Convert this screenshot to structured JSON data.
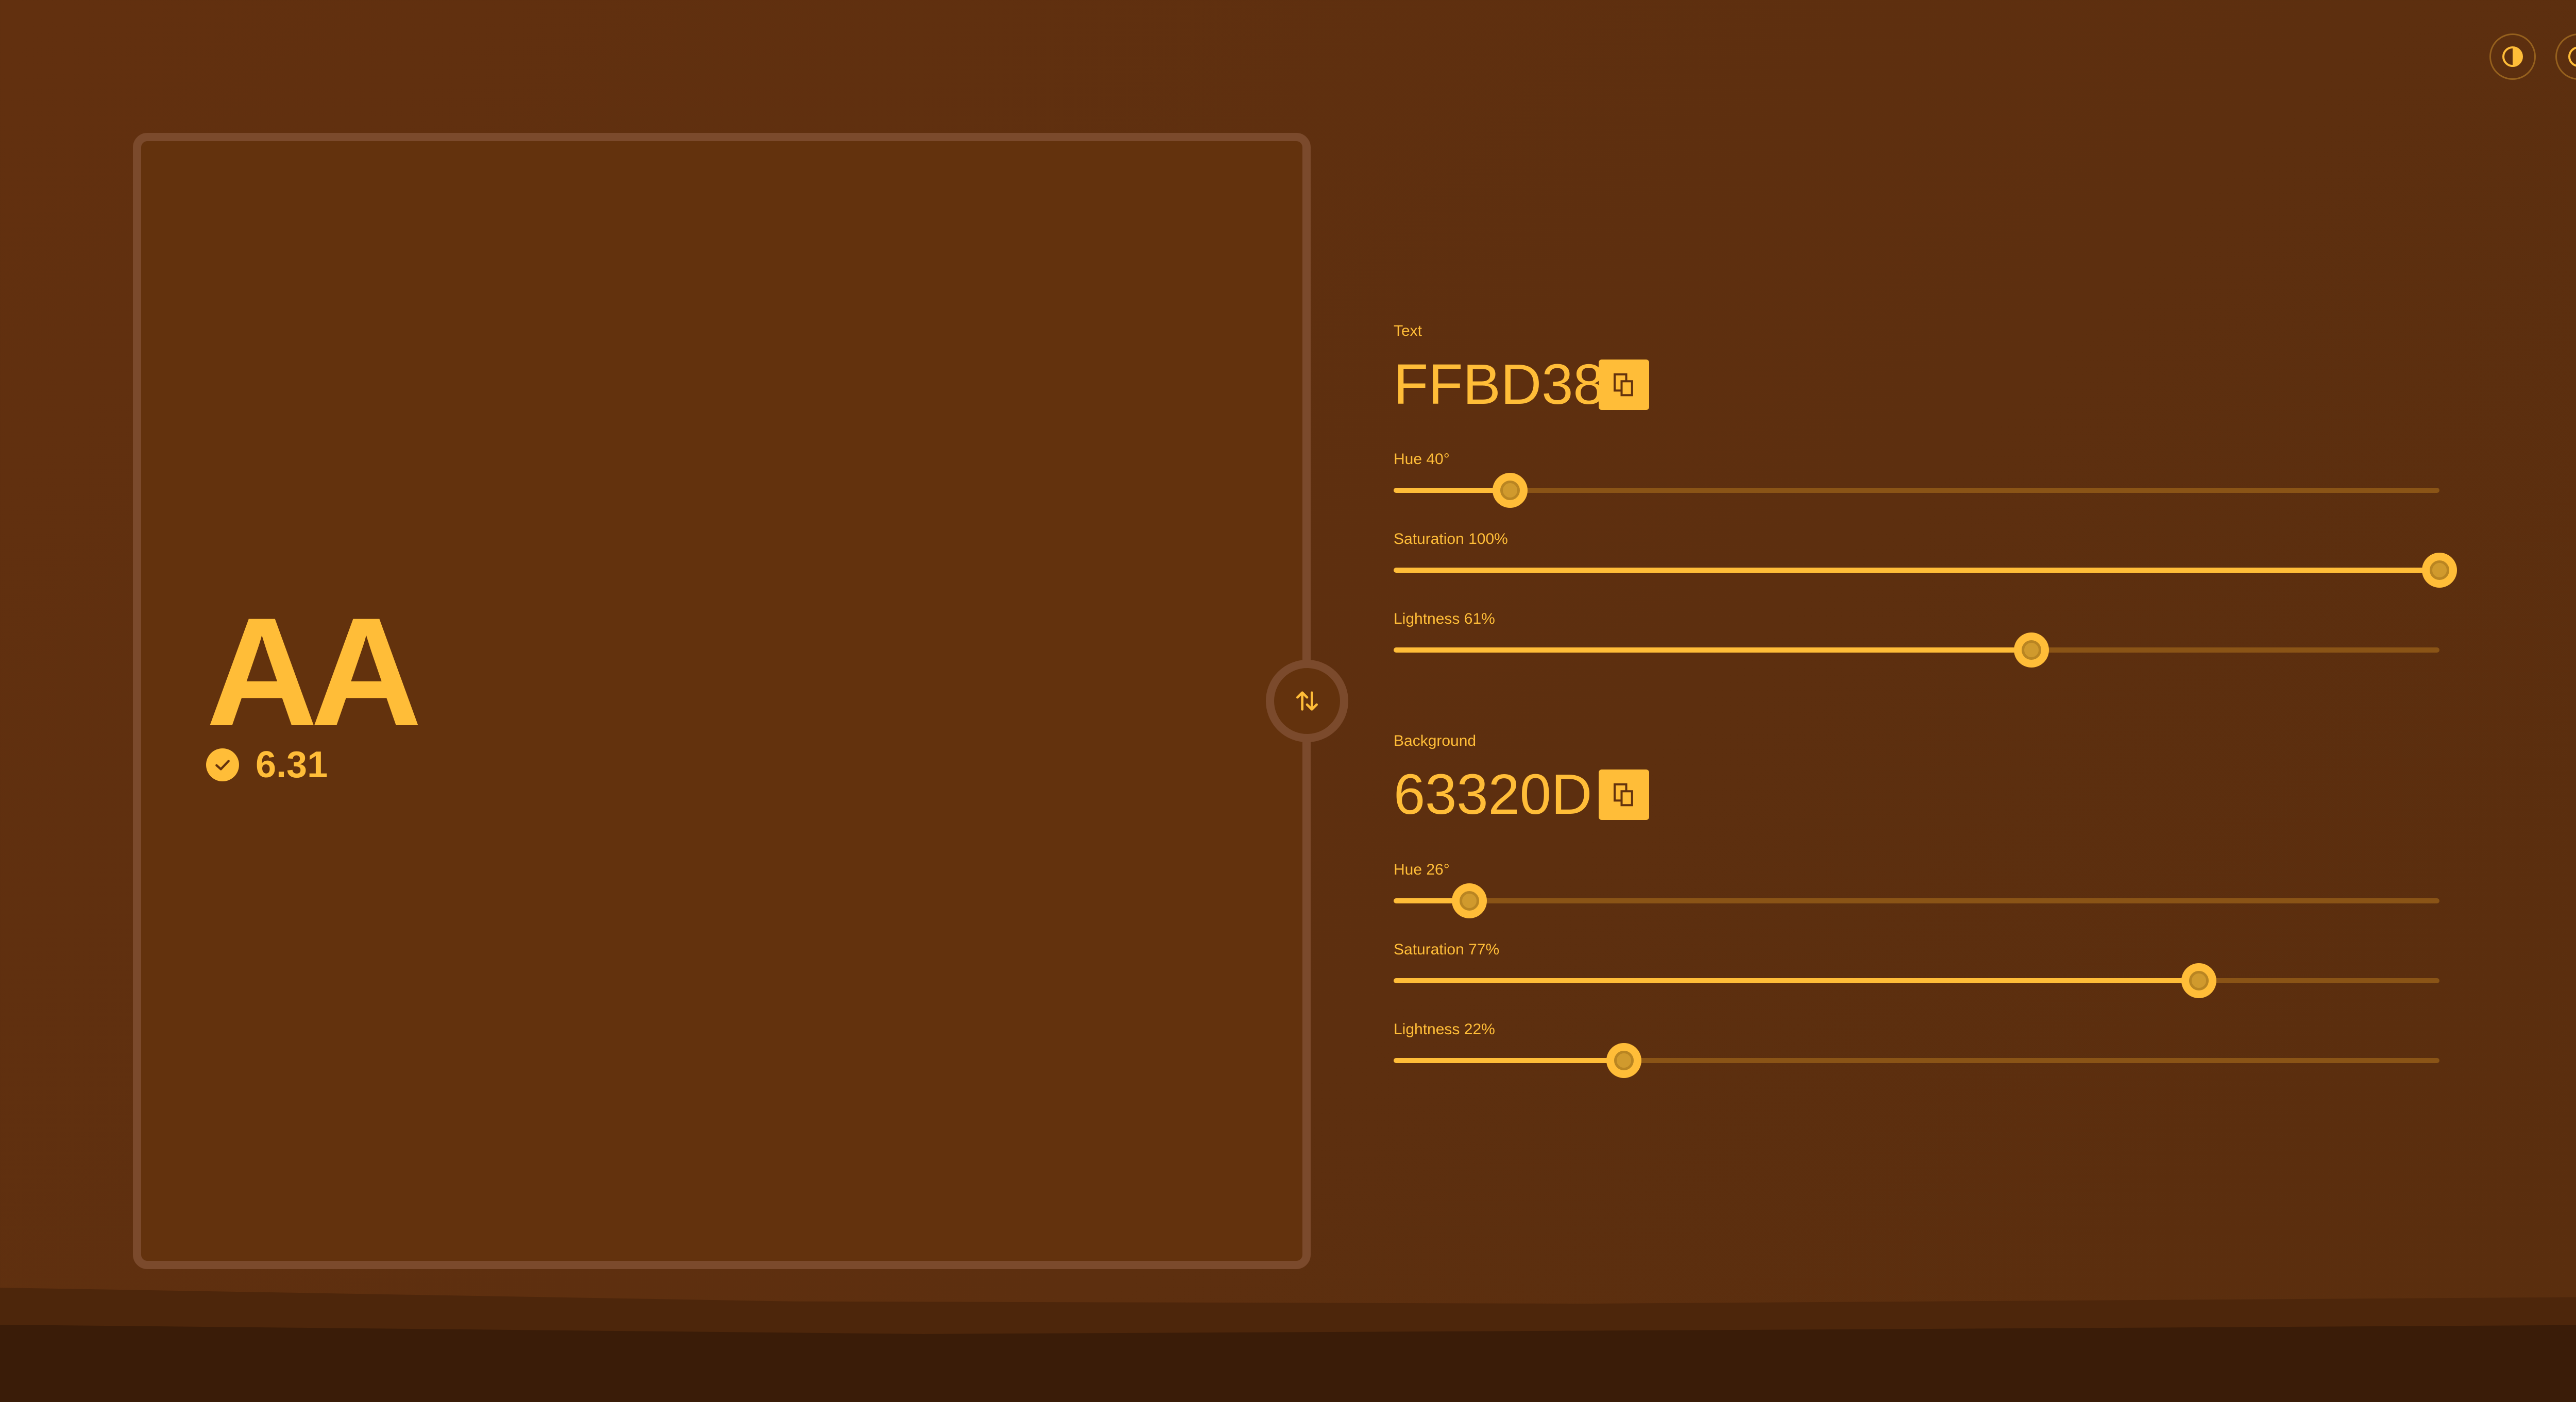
{
  "preview": {
    "sample_text": "AA",
    "contrast_ratio": "6.31"
  },
  "text_color": {
    "label": "Text",
    "hex": "FFBD38",
    "hue": {
      "label": "Hue 40°",
      "value": 40,
      "max": 360
    },
    "saturation": {
      "label": "Saturation 100%",
      "value": 100,
      "max": 100
    },
    "lightness": {
      "label": "Lightness 61%",
      "value": 61,
      "max": 100
    }
  },
  "background_color": {
    "label": "Background",
    "hex": "63320D",
    "hue": {
      "label": "Hue 26°",
      "value": 26,
      "max": 360
    },
    "saturation": {
      "label": "Saturation 77%",
      "value": 77,
      "max": 100
    },
    "lightness": {
      "label": "Lightness 22%",
      "value": 22,
      "max": 100
    }
  },
  "icons": {
    "contrast": "contrast-icon",
    "info": "info-icon",
    "swap": "swap-icon",
    "copy": "copy-icon",
    "check": "check-icon"
  },
  "colors": {
    "accent": "#FFBD38",
    "background": "#63320D"
  }
}
